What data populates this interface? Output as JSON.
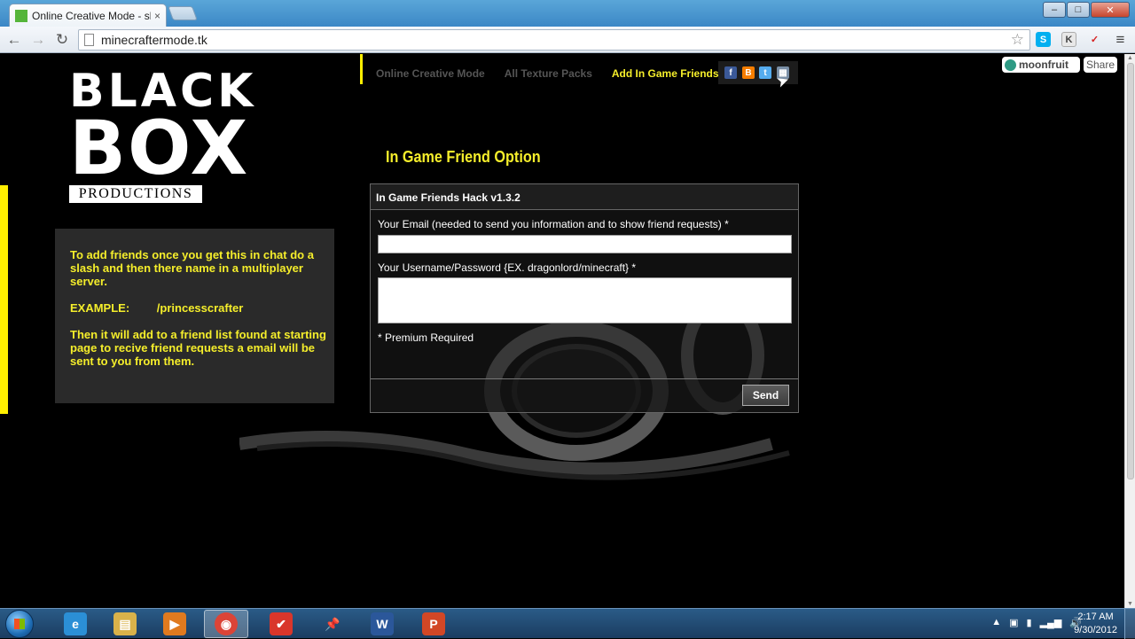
{
  "browser": {
    "tab_title": "Online Creative Mode - sh",
    "tab_close": "×",
    "url": "minecraftermode.tk",
    "back": "←",
    "forward": "→",
    "reload": "↻",
    "star": "☆",
    "menu": "≡",
    "extensions": [
      {
        "label": "S",
        "icon": "skype-icon"
      },
      {
        "label": "K",
        "icon": "k-extension-icon"
      },
      {
        "label": "✓",
        "icon": "flag-extension-icon"
      }
    ],
    "window_buttons": {
      "minimize": "–",
      "maximize": "□",
      "close": "✕"
    }
  },
  "site": {
    "logo_line1": "BLACK",
    "logo_line2": "BOX",
    "logo_line3": "PRODUCTIONS",
    "nav": [
      {
        "label": "Online Creative Mode",
        "active": false
      },
      {
        "label": "All Texture Packs",
        "active": false
      },
      {
        "label": "Add In Game Friends",
        "active": true
      }
    ],
    "social_icons": [
      "facebook-icon",
      "blogger-icon",
      "twitter-icon",
      "share-grid-icon"
    ],
    "moonfruit_label": "moonfruit",
    "share_label": "Share",
    "info": {
      "para1": "To add friends once you get this in chat do a slash and then there name in a multiplayer server.",
      "example_label": "EXAMPLE:",
      "example_value": "/princesscrafter",
      "para3": "Then it will add to a friend list found at starting page to recive friend requests a email will be sent to you from them."
    },
    "heading": "In Game Friend Option",
    "form": {
      "title": "In Game Friends Hack v1.3.2",
      "email_label": "Your Email (needed to send you information and to show friend requests) *",
      "email_value": "",
      "credentials_label": "Your Username/Password  {EX. dragonlord/minecraft} *",
      "credentials_value": "",
      "note": "* Premium Required",
      "send_label": "Send"
    }
  },
  "taskbar": {
    "apps": [
      {
        "name": "internet-explorer",
        "glyph": "e",
        "color": "#2b8fd6",
        "active": false
      },
      {
        "name": "file-explorer",
        "glyph": "▤",
        "color": "#d9b24a",
        "active": false
      },
      {
        "name": "media-player",
        "glyph": "▶",
        "color": "#e07a1f",
        "active": false
      },
      {
        "name": "chrome",
        "glyph": "◉",
        "color": "#dc4437",
        "active": true
      },
      {
        "name": "todoist",
        "glyph": "✔",
        "color": "#d9362b",
        "active": false
      },
      {
        "name": "pin-tool",
        "glyph": "📌",
        "color": "#c0292b",
        "active": false
      },
      {
        "name": "word",
        "glyph": "W",
        "color": "#2b579a",
        "active": false
      },
      {
        "name": "powerpoint",
        "glyph": "P",
        "color": "#d24726",
        "active": false
      }
    ],
    "time": "2:17 AM",
    "date": "9/30/2012"
  }
}
